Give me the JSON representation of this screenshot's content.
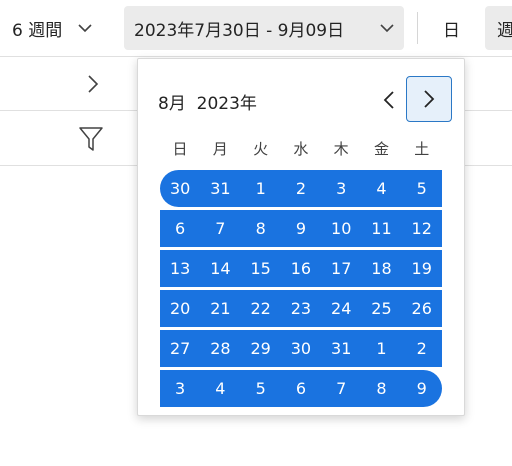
{
  "toolbar": {
    "weeks_label": "6 週間",
    "date_range": "2023年7月30日 - 9月09日",
    "day_label": "日",
    "week_label": "週"
  },
  "calendar": {
    "month_title": "8月  2023年",
    "weekdays": [
      "日",
      "月",
      "火",
      "水",
      "木",
      "金",
      "土"
    ],
    "weeks": [
      [
        "30",
        "31",
        "1",
        "2",
        "3",
        "4",
        "5"
      ],
      [
        "6",
        "7",
        "8",
        "9",
        "10",
        "11",
        "12"
      ],
      [
        "13",
        "14",
        "15",
        "16",
        "17",
        "18",
        "19"
      ],
      [
        "20",
        "21",
        "22",
        "23",
        "24",
        "25",
        "26"
      ],
      [
        "27",
        "28",
        "29",
        "30",
        "31",
        "1",
        "2"
      ],
      [
        "3",
        "4",
        "5",
        "6",
        "7",
        "8",
        "9"
      ]
    ]
  },
  "colors": {
    "selection": "#1a73e0",
    "accent_border": "#2b78c6"
  }
}
